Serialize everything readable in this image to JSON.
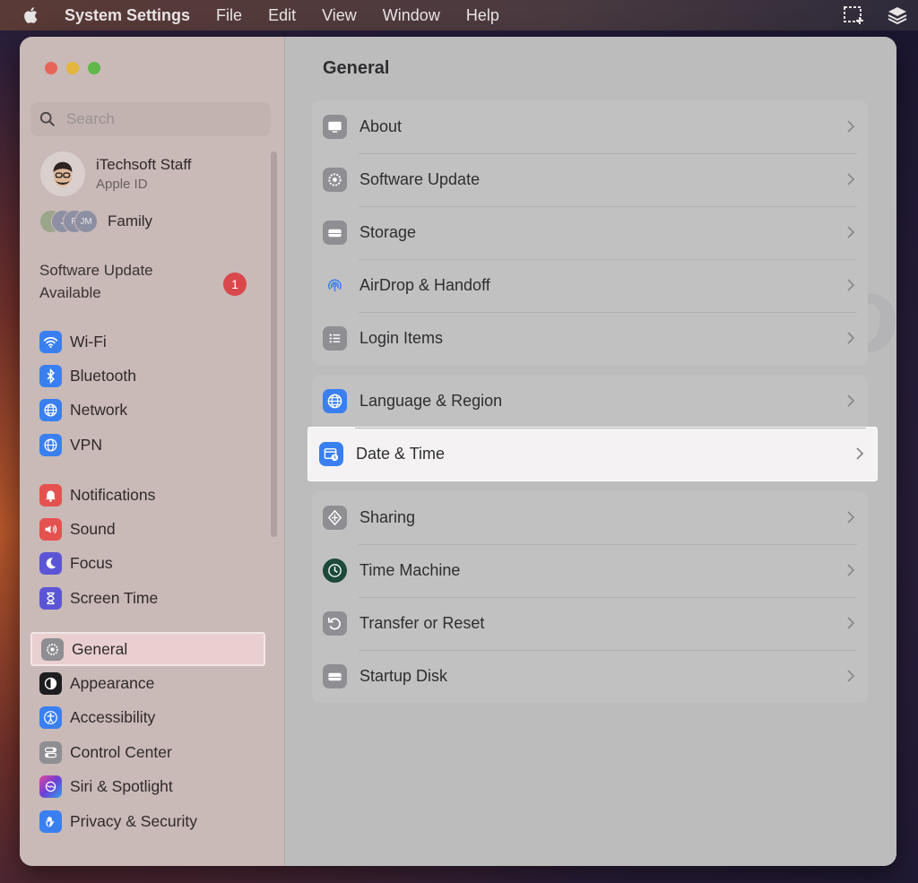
{
  "menubar": {
    "app_name": "System Settings",
    "items": [
      "File",
      "Edit",
      "View",
      "Window",
      "Help"
    ]
  },
  "sidebar": {
    "search_placeholder": "Search",
    "account": {
      "name": "iTechsoft Staff",
      "subtitle": "Apple ID"
    },
    "family": {
      "label": "Family",
      "initials": [
        "",
        "J",
        "R",
        "JM"
      ]
    },
    "software_update": {
      "text": "Software Update Available",
      "badge": "1"
    },
    "groups": [
      [
        {
          "label": "Wi-Fi",
          "icon": "wifi-icon",
          "color": "#3a7ff0"
        },
        {
          "label": "Bluetooth",
          "icon": "bluetooth-icon",
          "color": "#3a7ff0"
        },
        {
          "label": "Network",
          "icon": "globe-icon",
          "color": "#3a7ff0"
        },
        {
          "label": "VPN",
          "icon": "vpn-globe-icon",
          "color": "#3a7ff0"
        }
      ],
      [
        {
          "label": "Notifications",
          "icon": "bell-icon",
          "color": "#e4524f"
        },
        {
          "label": "Sound",
          "icon": "speaker-icon",
          "color": "#e4524f"
        },
        {
          "label": "Focus",
          "icon": "moon-icon",
          "color": "#5b55d6"
        },
        {
          "label": "Screen Time",
          "icon": "hourglass-icon",
          "color": "#5b55d6"
        }
      ],
      [
        {
          "label": "General",
          "icon": "gear-icon",
          "color": "#8e8e93",
          "selected": true
        },
        {
          "label": "Appearance",
          "icon": "appearance-icon",
          "color": "#1d1d1f"
        },
        {
          "label": "Accessibility",
          "icon": "accessibility-icon",
          "color": "#3a7ff0"
        },
        {
          "label": "Control Center",
          "icon": "toggles-icon",
          "color": "#8e8e93"
        },
        {
          "label": "Siri & Spotlight",
          "icon": "siri-icon",
          "color": "#7a3fd0"
        },
        {
          "label": "Privacy & Security",
          "icon": "hand-icon",
          "color": "#3a7ff0"
        }
      ]
    ]
  },
  "content": {
    "title": "General",
    "groups": [
      [
        {
          "label": "About",
          "icon": "display-icon",
          "color": "#8e8e93"
        },
        {
          "label": "Software Update",
          "icon": "gear-icon",
          "color": "#8e8e93"
        },
        {
          "label": "Storage",
          "icon": "drive-icon",
          "color": "#8e8e93"
        },
        {
          "label": "AirDrop & Handoff",
          "icon": "airdrop-icon",
          "color": "#3a7ff0"
        },
        {
          "label": "Login Items",
          "icon": "list-icon",
          "color": "#8e8e93"
        }
      ],
      [
        {
          "label": "Language & Region",
          "icon": "globe-icon",
          "color": "#3a7ff0"
        },
        {
          "label": "Date & Time",
          "icon": "calendar-clock-icon",
          "color": "#3a7ff0",
          "highlighted": true
        }
      ],
      [
        {
          "label": "Sharing",
          "icon": "sharing-icon",
          "color": "#8e8e93"
        },
        {
          "label": "Time Machine",
          "icon": "time-machine-icon",
          "color": "#1d4a3a"
        },
        {
          "label": "Transfer or Reset",
          "icon": "reset-icon",
          "color": "#8e8e93"
        },
        {
          "label": "Startup Disk",
          "icon": "drive-icon",
          "color": "#8e8e93"
        }
      ]
    ]
  }
}
